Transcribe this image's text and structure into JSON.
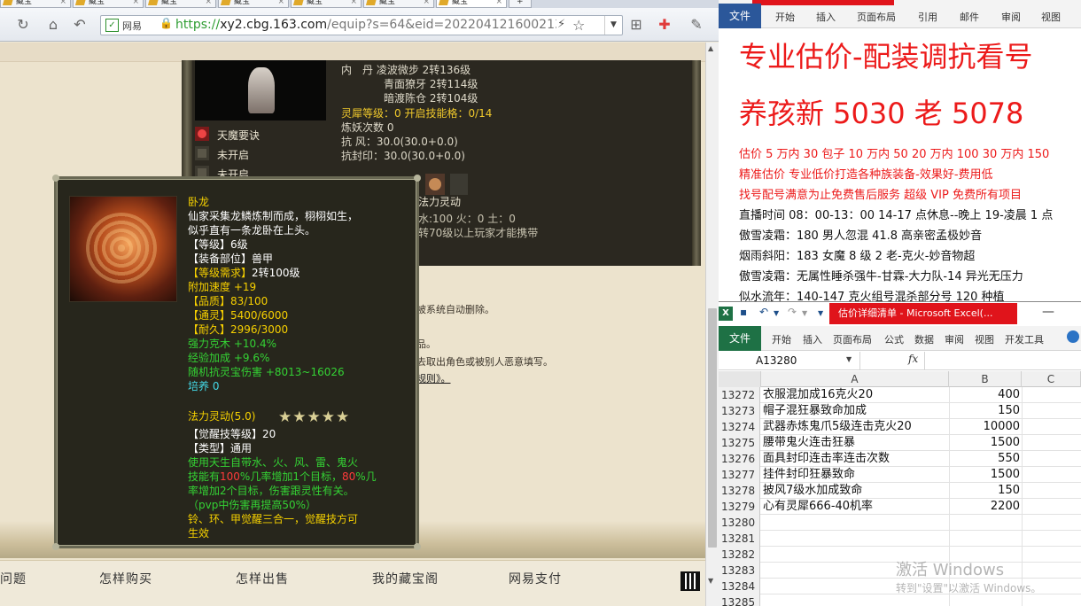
{
  "browser": {
    "tabs": [
      {
        "label": "藏宝"
      },
      {
        "label": "藏宝"
      },
      {
        "label": "藏宝"
      },
      {
        "label": "藏宝"
      },
      {
        "label": "藏宝"
      },
      {
        "label": "藏宝"
      },
      {
        "label": "藏宝"
      }
    ],
    "address": {
      "site_label": "网易",
      "scheme": "https://",
      "host": "xy2.cbg.163.com",
      "path": "/equip?s=64&eid=202204121600213-"
    }
  },
  "page": {
    "stats": {
      "line1": "内　丹  凌波微步  2转136级",
      "line2": "青面獠牙  2转114级",
      "line3": "暗渡陈仓  2转104级",
      "lingxi": "灵犀等级：0  开启技能格：0/14",
      "lianyao": "炼妖次数  0",
      "kangfeng": "抗  风：30.0(30.0+0.0)",
      "kangfengyin": "抗封印：30.0(30.0+0.0)"
    },
    "skills": [
      {
        "label": "天魔要诀"
      },
      {
        "label": "未开启"
      },
      {
        "label": "未开启"
      }
    ],
    "mid_texts": {
      "fali": "法力灵动",
      "elements": "水:100 火：0 土：0",
      "req": "转70级以上玩家才能携带",
      "auto": "被系统自动删除。",
      "pin": "品。",
      "warn": "去取出角色或被别人恶意填写。",
      "rules": "规则》。"
    },
    "footer_nav": [
      "问题",
      "怎样购买",
      "怎样出售",
      "我的藏宝阁",
      "网易支付"
    ]
  },
  "tooltip": {
    "name": "卧龙",
    "desc1": "仙家采集龙鳞炼制而成，栩栩如生，",
    "desc2": "似乎直有一条龙卧在上头。",
    "level": "【等级】6级",
    "slot_key": "【装备部位】",
    "slot_val": "兽甲",
    "req_key": "【等级需求】",
    "req_val": "2转100级",
    "speed": "附加速度 +19",
    "quality": "【品质】83/100",
    "tongling": "【通灵】5400/6000",
    "durability": "【耐久】2996/3000",
    "kemu": "强力克木 +10.4%",
    "exp": "经验加成 +9.6%",
    "rand": "随机抗灵宝伤害 +8013~16026",
    "peiyang": "培养 0",
    "skill": "法力灵动(5.0)",
    "stars": "★★★★★",
    "juexing": "【觉醒技等级】20",
    "type": "【类型】通用",
    "eff1": "使用天生自带水、火、风、雷、鬼火",
    "eff2a": "技能有",
    "eff2r": "100",
    "eff2b": "%几率增加1个目标，",
    "eff2r2": "80",
    "eff2c": "%几",
    "eff3": "率增加2个目标，伤害跟灵性有关。",
    "eff4": "（pvp中伤害再提高50%）",
    "note1": "铃、环、甲觉醒三合一，觉醒技方可",
    "note2": "生效"
  },
  "word": {
    "file_tab": "文件",
    "tabs": [
      "开始",
      "插入",
      "页面布局",
      "引用",
      "邮件",
      "审阅",
      "视图"
    ],
    "lines": [
      "专业估价-配装调抗看号",
      "养孩新 5030 老 5078",
      "估价 5 万内 30 包子   10 万内 50  20 万内 100  30 万内 150",
      "精准估价  专业低价打造各种族装备-效果好-费用低",
      "找号配号满意为止免费售后服务   超级 VIP 免费所有项目",
      "直播时间 08：00-13：00  14-17 点休息--晚上 19-凌晨 1 点",
      "傲雪凌霜：180 男人忽混 41.8 高亲密孟极妙音",
      "烟雨斜阳：183 女魔 8 级 2 老-克火-妙音物超",
      "傲雪凌霜：无属性睡杀强牛-甘霖-大力队-14 异光无压力",
      "似水流年：140-147 克火组号混杀部分号 120 种植"
    ]
  },
  "excel": {
    "title": "估价详细清单 - Microsoft Excel(...",
    "file_tab": "文件",
    "tabs": [
      "开始",
      "插入",
      "页面布局",
      "公式",
      "数据",
      "审阅",
      "视图",
      "开发工具"
    ],
    "namebox": "A13280",
    "fx": "fx",
    "columns": [
      "A",
      "B",
      "C"
    ],
    "rows": [
      {
        "n": "13272",
        "a": "衣服混加成16克火20",
        "b": "400"
      },
      {
        "n": "13273",
        "a": "帽子混狂暴致命加成",
        "b": "150"
      },
      {
        "n": "13274",
        "a": "武器赤炼鬼爪5级连击克火20",
        "b": "10000"
      },
      {
        "n": "13275",
        "a": "腰带鬼火连击狂暴",
        "b": "1500"
      },
      {
        "n": "13276",
        "a": "面具封印连击率连击次数",
        "b": "550"
      },
      {
        "n": "13277",
        "a": "挂件封印狂暴致命",
        "b": "1500"
      },
      {
        "n": "13278",
        "a": "披风7级水加成致命",
        "b": "150"
      },
      {
        "n": "13279",
        "a": "心有灵犀666-40机率",
        "b": "2200"
      },
      {
        "n": "13280",
        "a": "",
        "b": ""
      },
      {
        "n": "13281",
        "a": "",
        "b": ""
      },
      {
        "n": "13282",
        "a": "",
        "b": ""
      },
      {
        "n": "13283",
        "a": "",
        "b": ""
      },
      {
        "n": "13284",
        "a": "",
        "b": ""
      },
      {
        "n": "13285",
        "a": "",
        "b": ""
      }
    ],
    "watermark1": "激活 Windows",
    "watermark2": "转到\"设置\"以激活 Windows。"
  }
}
